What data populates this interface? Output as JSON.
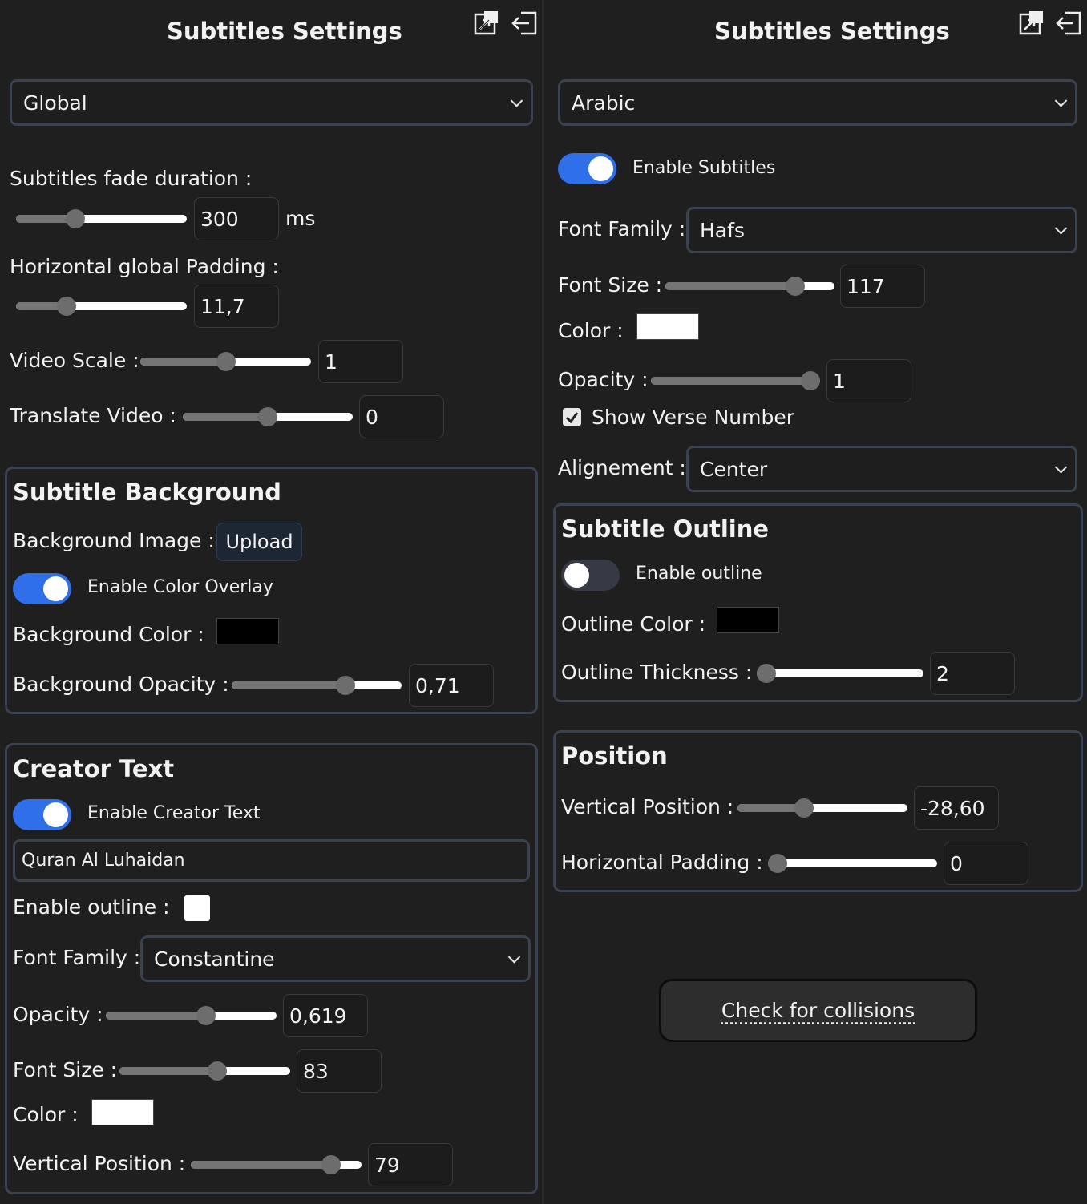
{
  "left": {
    "title": "Subtitles Settings",
    "scope_select": "Global",
    "fade_label": "Subtitles fade duration :",
    "fade_value": "300",
    "fade_unit": "ms",
    "fade_slider": 0.33,
    "hpad_label": "Horizontal global Padding :",
    "hpad_value": "11,7",
    "hpad_slider": 0.27,
    "scale_label": "Video Scale :",
    "scale_value": "1",
    "scale_slider": 0.5,
    "translate_label": "Translate Video :",
    "translate_value": "0",
    "translate_slider": 0.5,
    "background": {
      "title": "Subtitle Background",
      "image_label": "Background Image :",
      "upload_label": "Upload",
      "overlay_label": "Enable Color Overlay",
      "overlay_on": true,
      "color_label": "Background Color :",
      "color": "#000000",
      "opacity_label": "Background Opacity :",
      "opacity_value": "0,71",
      "opacity_slider": 0.69
    },
    "creator": {
      "title": "Creator Text",
      "enable_label": "Enable Creator Text",
      "enable_on": true,
      "text_value": "Quran Al Luhaidan",
      "outline_label": "Enable outline :",
      "outline_checked": false,
      "font_label": "Font Family :",
      "font_value": "Constantine",
      "opacity_label": "Opacity :",
      "opacity_value": "0,619",
      "opacity_slider": 0.6,
      "size_label": "Font Size :",
      "size_value": "83",
      "size_slider": 0.58,
      "color_label": "Color :",
      "color": "#ffffff",
      "vpos_label": "Vertical Position :",
      "vpos_value": "79",
      "vpos_slider": 0.86
    }
  },
  "right": {
    "title": "Subtitles Settings",
    "lang_select": "Arabic",
    "enable_label": "Enable Subtitles",
    "enable_on": true,
    "font_label": "Font Family :",
    "font_value": "Hafs",
    "size_label": "Font Size :",
    "size_value": "117",
    "size_slider": 0.8,
    "color_label": "Color :",
    "color": "#ffffff",
    "opacity_label": "Opacity :",
    "opacity_value": "1",
    "opacity_slider": 1.0,
    "verse_label": "Show Verse Number",
    "verse_checked": true,
    "align_label": "Alignement :",
    "align_value": "Center",
    "outline": {
      "title": "Subtitle Outline",
      "enable_label": "Enable outline",
      "enable_on": false,
      "color_label": "Outline Color :",
      "color": "#000000",
      "thickness_label": "Outline Thickness :",
      "thickness_value": "2",
      "thickness_slider": 0.0
    },
    "position": {
      "title": "Position",
      "vpos_label": "Vertical Position :",
      "vpos_value": "-28,60",
      "vpos_slider": 0.38,
      "hpad_label": "Horizontal Padding :",
      "hpad_value": "0",
      "hpad_slider": 0.0
    },
    "collisions_label": "Check for collisions"
  },
  "icons": [
    "popout-icon",
    "exit-icon"
  ],
  "accent": "#2f6fea"
}
